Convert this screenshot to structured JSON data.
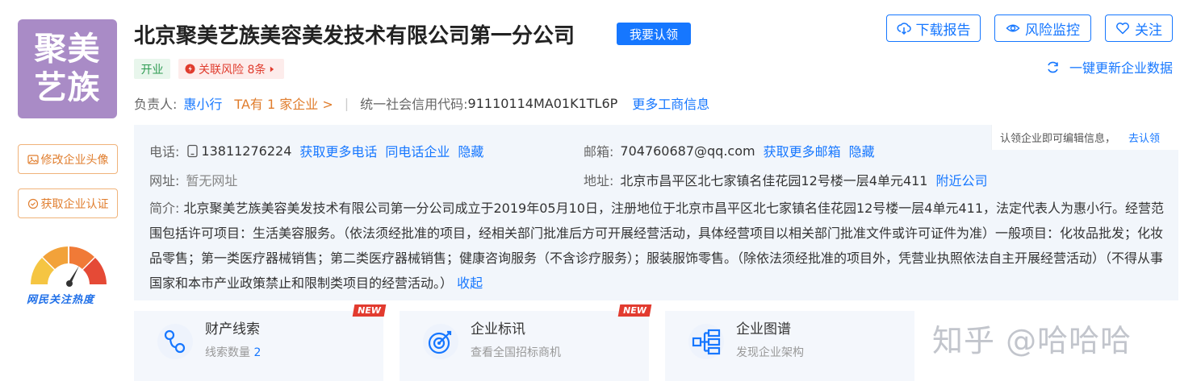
{
  "company": {
    "logo_text_line1": "聚美",
    "logo_text_line2": "艺族",
    "name": "北京聚美艺族美容美发技术有限公司第一分公司",
    "claim_button": "我要认领",
    "status": "开业",
    "risk": "关联风险 8条",
    "refresh": "一键更新企业数据"
  },
  "actions": {
    "download": "下载报告",
    "monitor": "风险监控",
    "follow": "关注"
  },
  "side": {
    "edit_avatar": "修改企业头像",
    "get_cert": "获取企业认证",
    "heat_label": "网民关注热度"
  },
  "meta": {
    "owner_label": "负责人:",
    "owner": "惠小行",
    "owner_has": "TA有 1 家企业 >",
    "credit_label": "统一社会信用代码:",
    "credit_code": "91110114MA01K1TL6P",
    "more_info": "更多工商信息"
  },
  "contact": {
    "claim_note": "认领企业即可编辑信息，",
    "claim_link": "去认领",
    "phone_label": "电话:",
    "phone": "13811276224",
    "more_phone": "获取更多电话",
    "same_phone": "同电话企业",
    "hide1": "隐藏",
    "email_label": "邮箱:",
    "email": "704760687@qq.com",
    "more_email": "获取更多邮箱",
    "hide2": "隐藏",
    "site_label": "网址:",
    "site": "暂无网址",
    "addr_label": "地址:",
    "addr": "北京市昌平区北七家镇名佳花园12号楼一层4单元411",
    "nearby": "附近公司",
    "intro_label": "简介:",
    "intro": "北京聚美艺族美容美发技术有限公司第一分公司成立于2019年05月10日，注册地位于北京市昌平区北七家镇名佳花园12号楼一层4单元411，法定代表人为惠小行。经营范围包括许可项目：生活美容服务。（依法须经批准的项目，经相关部门批准后方可开展经营活动，具体经营项目以相关部门批准文件或许可证件为准）一般项目：化妆品批发；化妆品零售；第一类医疗器械销售；第二类医疗器械销售；健康咨询服务（不含诊疗服务）；服装服饰零售。（除依法须经批准的项目外，凭营业执照依法自主开展经营活动）（不得从事国家和本市产业政策禁止和限制类项目的经营活动。）",
    "collapse": "收起"
  },
  "cards": [
    {
      "title": "财产线索",
      "sub": "线索数量",
      "count": "2",
      "badge": "NEW"
    },
    {
      "title": "企业标讯",
      "sub": "查看全国招标商机",
      "badge": "NEW"
    },
    {
      "title": "企业图谱",
      "sub": "发现企业架构"
    }
  ],
  "watermark": "知乎 @哈哈哈"
}
